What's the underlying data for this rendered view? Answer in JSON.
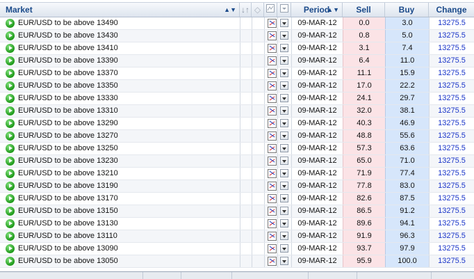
{
  "header": {
    "market": "Market",
    "period": "Period",
    "sell": "Sell",
    "buy": "Buy",
    "change": "Change"
  },
  "rows": [
    {
      "market": "EUR/USD to be above 13490",
      "period": "09-MAR-12",
      "sell": "0.0",
      "buy": "3.0",
      "change": "13275.5"
    },
    {
      "market": "EUR/USD to be above 13430",
      "period": "09-MAR-12",
      "sell": "0.8",
      "buy": "5.0",
      "change": "13275.5"
    },
    {
      "market": "EUR/USD to be above 13410",
      "period": "09-MAR-12",
      "sell": "3.1",
      "buy": "7.4",
      "change": "13275.5"
    },
    {
      "market": "EUR/USD to be above 13390",
      "period": "09-MAR-12",
      "sell": "6.4",
      "buy": "11.0",
      "change": "13275.5"
    },
    {
      "market": "EUR/USD to be above 13370",
      "period": "09-MAR-12",
      "sell": "11.1",
      "buy": "15.9",
      "change": "13275.5"
    },
    {
      "market": "EUR/USD to be above 13350",
      "period": "09-MAR-12",
      "sell": "17.0",
      "buy": "22.2",
      "change": "13275.5"
    },
    {
      "market": "EUR/USD to be above 13330",
      "period": "09-MAR-12",
      "sell": "24.1",
      "buy": "29.7",
      "change": "13275.5"
    },
    {
      "market": "EUR/USD to be above 13310",
      "period": "09-MAR-12",
      "sell": "32.0",
      "buy": "38.1",
      "change": "13275.5"
    },
    {
      "market": "EUR/USD to be above 13290",
      "period": "09-MAR-12",
      "sell": "40.3",
      "buy": "46.9",
      "change": "13275.5"
    },
    {
      "market": "EUR/USD to be above 13270",
      "period": "09-MAR-12",
      "sell": "48.8",
      "buy": "55.6",
      "change": "13275.5"
    },
    {
      "market": "EUR/USD to be above 13250",
      "period": "09-MAR-12",
      "sell": "57.3",
      "buy": "63.6",
      "change": "13275.5"
    },
    {
      "market": "EUR/USD to be above 13230",
      "period": "09-MAR-12",
      "sell": "65.0",
      "buy": "71.0",
      "change": "13275.5"
    },
    {
      "market": "EUR/USD to be above 13210",
      "period": "09-MAR-12",
      "sell": "71.9",
      "buy": "77.4",
      "change": "13275.5"
    },
    {
      "market": "EUR/USD to be above 13190",
      "period": "09-MAR-12",
      "sell": "77.8",
      "buy": "83.0",
      "change": "13275.5"
    },
    {
      "market": "EUR/USD to be above 13170",
      "period": "09-MAR-12",
      "sell": "82.6",
      "buy": "87.5",
      "change": "13275.5"
    },
    {
      "market": "EUR/USD to be above 13150",
      "period": "09-MAR-12",
      "sell": "86.5",
      "buy": "91.2",
      "change": "13275.5"
    },
    {
      "market": "EUR/USD to be above 13130",
      "period": "09-MAR-12",
      "sell": "89.6",
      "buy": "94.1",
      "change": "13275.5"
    },
    {
      "market": "EUR/USD to be above 13110",
      "period": "09-MAR-12",
      "sell": "91.9",
      "buy": "96.3",
      "change": "13275.5"
    },
    {
      "market": "EUR/USD to be above 13090",
      "period": "09-MAR-12",
      "sell": "93.7",
      "buy": "97.9",
      "change": "13275.5"
    },
    {
      "market": "EUR/USD to be above 13050",
      "period": "09-MAR-12",
      "sell": "95.9",
      "buy": "100.0",
      "change": "13275.5"
    }
  ],
  "icons": {
    "row_action": "play-icon",
    "chart": "chart-icon",
    "dropdown": "chevron-down-icon",
    "sort": "sort-arrows-icon",
    "tag": "tag-icon"
  },
  "colors": {
    "header_text": "#1b4a8a",
    "sell_bg": "#fbe3e6",
    "buy_bg": "#d6e6fb",
    "change_text": "#1a35c9",
    "play_green": "#1f9a1a"
  }
}
